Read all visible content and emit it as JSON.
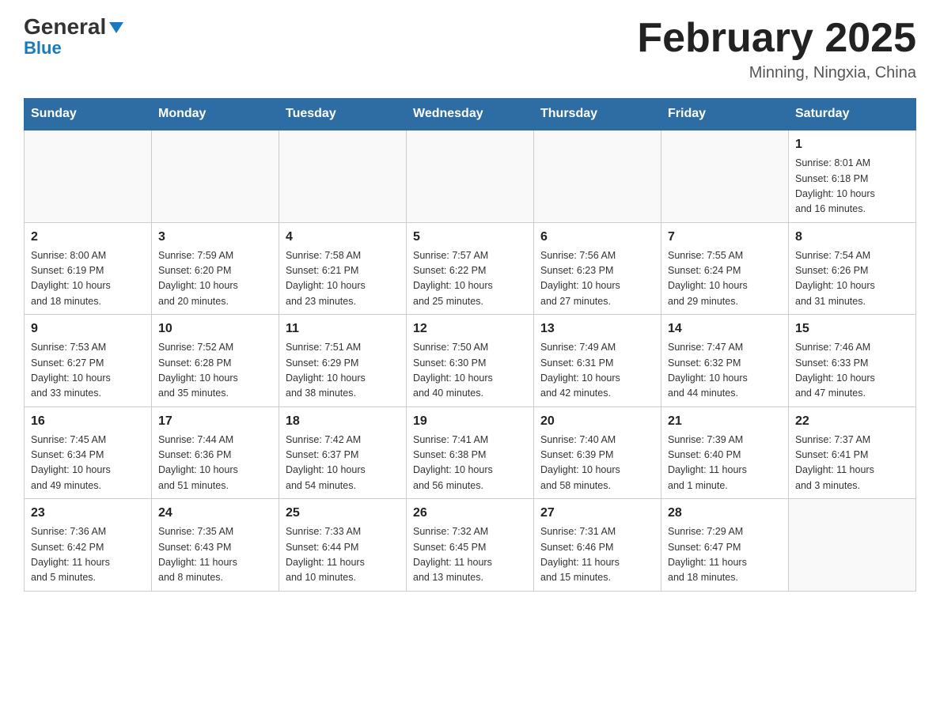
{
  "header": {
    "logo_general": "General",
    "logo_blue": "Blue",
    "title": "February 2025",
    "location": "Minning, Ningxia, China"
  },
  "days_of_week": [
    "Sunday",
    "Monday",
    "Tuesday",
    "Wednesday",
    "Thursday",
    "Friday",
    "Saturday"
  ],
  "weeks": [
    [
      {
        "day": "",
        "info": ""
      },
      {
        "day": "",
        "info": ""
      },
      {
        "day": "",
        "info": ""
      },
      {
        "day": "",
        "info": ""
      },
      {
        "day": "",
        "info": ""
      },
      {
        "day": "",
        "info": ""
      },
      {
        "day": "1",
        "info": "Sunrise: 8:01 AM\nSunset: 6:18 PM\nDaylight: 10 hours\nand 16 minutes."
      }
    ],
    [
      {
        "day": "2",
        "info": "Sunrise: 8:00 AM\nSunset: 6:19 PM\nDaylight: 10 hours\nand 18 minutes."
      },
      {
        "day": "3",
        "info": "Sunrise: 7:59 AM\nSunset: 6:20 PM\nDaylight: 10 hours\nand 20 minutes."
      },
      {
        "day": "4",
        "info": "Sunrise: 7:58 AM\nSunset: 6:21 PM\nDaylight: 10 hours\nand 23 minutes."
      },
      {
        "day": "5",
        "info": "Sunrise: 7:57 AM\nSunset: 6:22 PM\nDaylight: 10 hours\nand 25 minutes."
      },
      {
        "day": "6",
        "info": "Sunrise: 7:56 AM\nSunset: 6:23 PM\nDaylight: 10 hours\nand 27 minutes."
      },
      {
        "day": "7",
        "info": "Sunrise: 7:55 AM\nSunset: 6:24 PM\nDaylight: 10 hours\nand 29 minutes."
      },
      {
        "day": "8",
        "info": "Sunrise: 7:54 AM\nSunset: 6:26 PM\nDaylight: 10 hours\nand 31 minutes."
      }
    ],
    [
      {
        "day": "9",
        "info": "Sunrise: 7:53 AM\nSunset: 6:27 PM\nDaylight: 10 hours\nand 33 minutes."
      },
      {
        "day": "10",
        "info": "Sunrise: 7:52 AM\nSunset: 6:28 PM\nDaylight: 10 hours\nand 35 minutes."
      },
      {
        "day": "11",
        "info": "Sunrise: 7:51 AM\nSunset: 6:29 PM\nDaylight: 10 hours\nand 38 minutes."
      },
      {
        "day": "12",
        "info": "Sunrise: 7:50 AM\nSunset: 6:30 PM\nDaylight: 10 hours\nand 40 minutes."
      },
      {
        "day": "13",
        "info": "Sunrise: 7:49 AM\nSunset: 6:31 PM\nDaylight: 10 hours\nand 42 minutes."
      },
      {
        "day": "14",
        "info": "Sunrise: 7:47 AM\nSunset: 6:32 PM\nDaylight: 10 hours\nand 44 minutes."
      },
      {
        "day": "15",
        "info": "Sunrise: 7:46 AM\nSunset: 6:33 PM\nDaylight: 10 hours\nand 47 minutes."
      }
    ],
    [
      {
        "day": "16",
        "info": "Sunrise: 7:45 AM\nSunset: 6:34 PM\nDaylight: 10 hours\nand 49 minutes."
      },
      {
        "day": "17",
        "info": "Sunrise: 7:44 AM\nSunset: 6:36 PM\nDaylight: 10 hours\nand 51 minutes."
      },
      {
        "day": "18",
        "info": "Sunrise: 7:42 AM\nSunset: 6:37 PM\nDaylight: 10 hours\nand 54 minutes."
      },
      {
        "day": "19",
        "info": "Sunrise: 7:41 AM\nSunset: 6:38 PM\nDaylight: 10 hours\nand 56 minutes."
      },
      {
        "day": "20",
        "info": "Sunrise: 7:40 AM\nSunset: 6:39 PM\nDaylight: 10 hours\nand 58 minutes."
      },
      {
        "day": "21",
        "info": "Sunrise: 7:39 AM\nSunset: 6:40 PM\nDaylight: 11 hours\nand 1 minute."
      },
      {
        "day": "22",
        "info": "Sunrise: 7:37 AM\nSunset: 6:41 PM\nDaylight: 11 hours\nand 3 minutes."
      }
    ],
    [
      {
        "day": "23",
        "info": "Sunrise: 7:36 AM\nSunset: 6:42 PM\nDaylight: 11 hours\nand 5 minutes."
      },
      {
        "day": "24",
        "info": "Sunrise: 7:35 AM\nSunset: 6:43 PM\nDaylight: 11 hours\nand 8 minutes."
      },
      {
        "day": "25",
        "info": "Sunrise: 7:33 AM\nSunset: 6:44 PM\nDaylight: 11 hours\nand 10 minutes."
      },
      {
        "day": "26",
        "info": "Sunrise: 7:32 AM\nSunset: 6:45 PM\nDaylight: 11 hours\nand 13 minutes."
      },
      {
        "day": "27",
        "info": "Sunrise: 7:31 AM\nSunset: 6:46 PM\nDaylight: 11 hours\nand 15 minutes."
      },
      {
        "day": "28",
        "info": "Sunrise: 7:29 AM\nSunset: 6:47 PM\nDaylight: 11 hours\nand 18 minutes."
      },
      {
        "day": "",
        "info": ""
      }
    ]
  ]
}
